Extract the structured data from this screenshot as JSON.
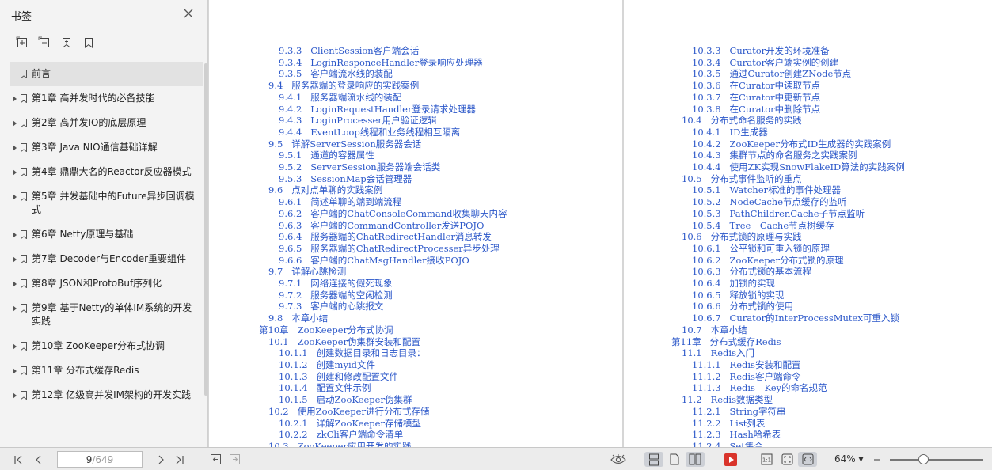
{
  "sidebar": {
    "title": "书签",
    "close_icon": "close-icon",
    "tools": [
      "expand-all-icon",
      "collapse-all-icon",
      "add-bookmark-icon",
      "bookmark-icon"
    ],
    "items": [
      {
        "label": "前言",
        "arrow": false,
        "selected": true
      },
      {
        "label": "第1章 高并发时代的必备技能",
        "arrow": true
      },
      {
        "label": "第2章 高并发IO的底层原理",
        "arrow": true
      },
      {
        "label": "第3章 Java NIO通信基础详解",
        "arrow": true
      },
      {
        "label": "第4章 鼎鼎大名的Reactor反应器模式",
        "arrow": true
      },
      {
        "label": "第5章 并发基础中的Future异步回调模式",
        "arrow": true
      },
      {
        "label": "第6章 Netty原理与基础",
        "arrow": true
      },
      {
        "label": "第7章 Decoder与Encoder重要组件",
        "arrow": true
      },
      {
        "label": "第8章 JSON和ProtoBuf序列化",
        "arrow": true
      },
      {
        "label": "第9章 基于Netty的单体IM系统的开发实践",
        "arrow": true
      },
      {
        "label": "第10章 ZooKeeper分布式协调",
        "arrow": true
      },
      {
        "label": "第11章 分布式缓存Redis",
        "arrow": true
      },
      {
        "label": "第12章 亿级高并发IM架构的开发实践",
        "arrow": true
      }
    ]
  },
  "left_page": {
    "lines": [
      {
        "num": "9.3.3",
        "text": "ClientSession客户端会话",
        "level": 3
      },
      {
        "num": "9.3.4",
        "text": "LoginResponceHandler登录响应处理器",
        "level": 3
      },
      {
        "num": "9.3.5",
        "text": "客户端流水线的装配",
        "level": 3
      },
      {
        "num": "9.4",
        "text": "服务器端的登录响应的实践案例",
        "level": 2
      },
      {
        "num": "9.4.1",
        "text": "服务器端流水线的装配",
        "level": 3
      },
      {
        "num": "9.4.2",
        "text": "LoginRequestHandler登录请求处理器",
        "level": 3
      },
      {
        "num": "9.4.3",
        "text": "LoginProcesser用户验证逻辑",
        "level": 3
      },
      {
        "num": "9.4.4",
        "text": "EventLoop线程和业务线程相互隔离",
        "level": 3
      },
      {
        "num": "9.5",
        "text": "详解ServerSession服务器会话",
        "level": 2
      },
      {
        "num": "9.5.1",
        "text": "通道的容器属性",
        "level": 3
      },
      {
        "num": "9.5.2",
        "text": "ServerSession服务器端会话类",
        "level": 3
      },
      {
        "num": "9.5.3",
        "text": "SessionMap会话管理器",
        "level": 3
      },
      {
        "num": "9.6",
        "text": "点对点单聊的实践案例",
        "level": 2
      },
      {
        "num": "9.6.1",
        "text": "简述单聊的端到端流程",
        "level": 3
      },
      {
        "num": "9.6.2",
        "text": "客户端的ChatConsoleCommand收集聊天内容",
        "level": 3
      },
      {
        "num": "9.6.3",
        "text": "客户端的CommandController发送POJO",
        "level": 3
      },
      {
        "num": "9.6.4",
        "text": "服务器端的ChatRedirectHandler消息转发",
        "level": 3
      },
      {
        "num": "9.6.5",
        "text": "服务器端的ChatRedirectProcesser异步处理",
        "level": 3
      },
      {
        "num": "9.6.6",
        "text": "客户端的ChatMsgHandler接收POJO",
        "level": 3
      },
      {
        "num": "9.7",
        "text": "详解心跳检测",
        "level": 2
      },
      {
        "num": "9.7.1",
        "text": "网络连接的假死现象",
        "level": 3
      },
      {
        "num": "9.7.2",
        "text": "服务器端的空闲检测",
        "level": 3
      },
      {
        "num": "9.7.3",
        "text": "客户端的心跳报文",
        "level": 3
      },
      {
        "num": "9.8",
        "text": "本章小结",
        "level": 2
      },
      {
        "num": "第10章",
        "text": "ZooKeeper分布式协调",
        "level": 1
      },
      {
        "num": "10.1",
        "text": "ZooKeeper伪集群安装和配置",
        "level": 2
      },
      {
        "num": "10.1.1",
        "text": "创建数据目录和日志目录：",
        "level": 3
      },
      {
        "num": "10.1.2",
        "text": "创建myid文件",
        "level": 3
      },
      {
        "num": "10.1.3",
        "text": "创建和修改配置文件",
        "level": 3
      },
      {
        "num": "10.1.4",
        "text": "配置文件示例",
        "level": 3
      },
      {
        "num": "10.1.5",
        "text": "启动ZooKeeper伪集群",
        "level": 3
      },
      {
        "num": "10.2",
        "text": "使用ZooKeeper进行分布式存储",
        "level": 2
      },
      {
        "num": "10.2.1",
        "text": "详解ZooKeeper存储模型",
        "level": 3
      },
      {
        "num": "10.2.2",
        "text": "zkCli客户端命令清单",
        "level": 3
      },
      {
        "num": "10.3",
        "text": "ZooKeeper应用开发的实践",
        "level": 2
      }
    ]
  },
  "right_page": {
    "lines": [
      {
        "num": "10.3.3",
        "text": "Curator开发的环境准备",
        "level": 3
      },
      {
        "num": "10.3.4",
        "text": "Curator客户端实例的创建",
        "level": 3
      },
      {
        "num": "10.3.5",
        "text": "通过Curator创建ZNode节点",
        "level": 3
      },
      {
        "num": "10.3.6",
        "text": "在Curator中读取节点",
        "level": 3
      },
      {
        "num": "10.3.7",
        "text": "在Curator中更新节点",
        "level": 3
      },
      {
        "num": "10.3.8",
        "text": "在Curator中删除节点",
        "level": 3
      },
      {
        "num": "10.4",
        "text": "分布式命名服务的实践",
        "level": 2
      },
      {
        "num": "10.4.1",
        "text": "ID生成器",
        "level": 3
      },
      {
        "num": "10.4.2",
        "text": "ZooKeeper分布式ID生成器的实践案例",
        "level": 3
      },
      {
        "num": "10.4.3",
        "text": "集群节点的命名服务之实践案例",
        "level": 3
      },
      {
        "num": "10.4.4",
        "text": "使用ZK实现SnowFlakeID算法的实践案例",
        "level": 3
      },
      {
        "num": "10.5",
        "text": "分布式事件监听的重点",
        "level": 2
      },
      {
        "num": "10.5.1",
        "text": "Watcher标准的事件处理器",
        "level": 3
      },
      {
        "num": "10.5.2",
        "text": "NodeCache节点缓存的监听",
        "level": 3
      },
      {
        "num": "10.5.3",
        "text": "PathChildrenCache子节点监听",
        "level": 3
      },
      {
        "num": "10.5.4",
        "text": "Tree　Cache节点树缓存",
        "level": 3
      },
      {
        "num": "10.6",
        "text": "分布式锁的原理与实践",
        "level": 2
      },
      {
        "num": "10.6.1",
        "text": "公平锁和可重入锁的原理",
        "level": 3
      },
      {
        "num": "10.6.2",
        "text": "ZooKeeper分布式锁的原理",
        "level": 3
      },
      {
        "num": "10.6.3",
        "text": "分布式锁的基本流程",
        "level": 3
      },
      {
        "num": "10.6.4",
        "text": "加锁的实现",
        "level": 3
      },
      {
        "num": "10.6.5",
        "text": "释放锁的实现",
        "level": 3
      },
      {
        "num": "10.6.6",
        "text": "分布式锁的使用",
        "level": 3
      },
      {
        "num": "10.6.7",
        "text": "Curator的InterProcessMutex可重入锁",
        "level": 3
      },
      {
        "num": "10.7",
        "text": "本章小结",
        "level": 2
      },
      {
        "num": "第11章",
        "text": "分布式缓存Redis",
        "level": 1
      },
      {
        "num": "11.1",
        "text": "Redis入门",
        "level": 2
      },
      {
        "num": "11.1.1",
        "text": "Redis安装和配置",
        "level": 3
      },
      {
        "num": "11.1.2",
        "text": "Redis客户端命令",
        "level": 3
      },
      {
        "num": "11.1.3",
        "text": "Redis　Key的命名规范",
        "level": 3
      },
      {
        "num": "11.2",
        "text": "Redis数据类型",
        "level": 2
      },
      {
        "num": "11.2.1",
        "text": "String字符串",
        "level": 3
      },
      {
        "num": "11.2.2",
        "text": "List列表",
        "level": 3
      },
      {
        "num": "11.2.3",
        "text": "Hash哈希表",
        "level": 3
      },
      {
        "num": "11.2.4",
        "text": "Set集合",
        "level": 3
      }
    ]
  },
  "toolbar": {
    "current_page": "9",
    "total_pages": "/649",
    "zoom": "64%",
    "zoom_level_percent": 64,
    "accent_color": "#2b57c9",
    "record_color": "#d9342b"
  }
}
